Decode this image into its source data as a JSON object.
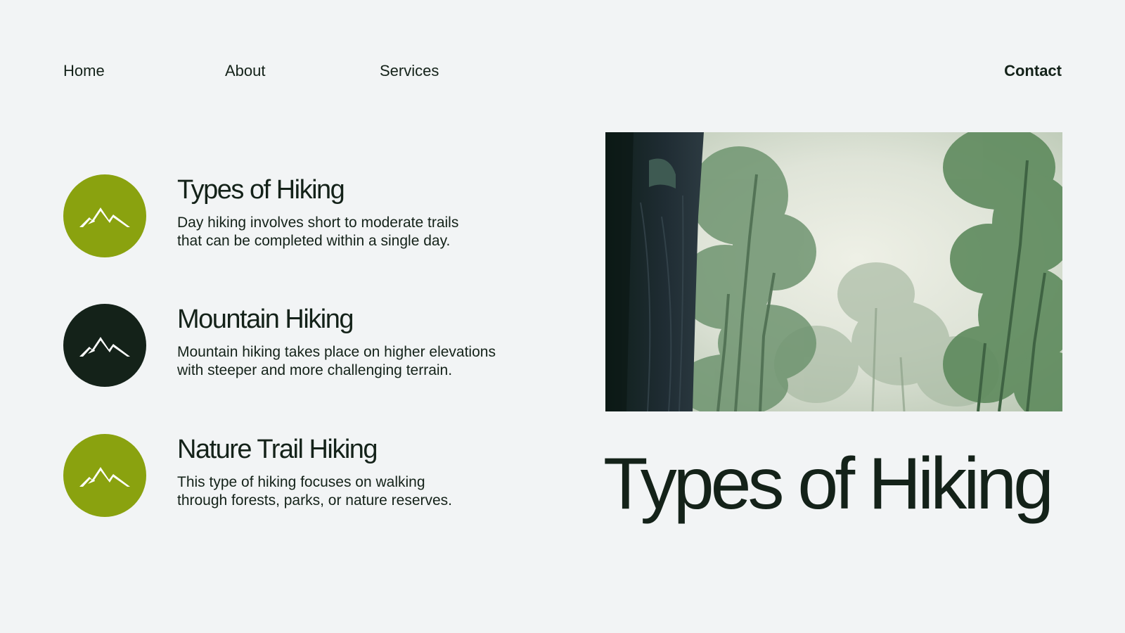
{
  "nav": {
    "home": "Home",
    "about": "About",
    "services": "Services",
    "contact": "Contact"
  },
  "features": [
    {
      "title": "Types of Hiking",
      "description_line1": "Day hiking involves short to moderate trails",
      "description_line2": "that can be completed within a single day.",
      "icon": "mountain-icon",
      "color": "#8aa20f"
    },
    {
      "title": "Mountain Hiking",
      "description_line1": "Mountain hiking takes place on higher elevations",
      "description_line2": "with steeper and more challenging terrain.",
      "icon": "mountain-icon",
      "color": "#142219"
    },
    {
      "title": "Nature Trail Hiking",
      "description_line1": "This type of hiking focuses on walking",
      "description_line2": "through forests, parks, or nature reserves.",
      "icon": "mountain-icon",
      "color": "#8aa20f"
    }
  ],
  "hero": {
    "title": "Types of Hiking"
  },
  "colors": {
    "background": "#f2f4f5",
    "accent_green": "#8aa20f",
    "dark": "#142219"
  }
}
